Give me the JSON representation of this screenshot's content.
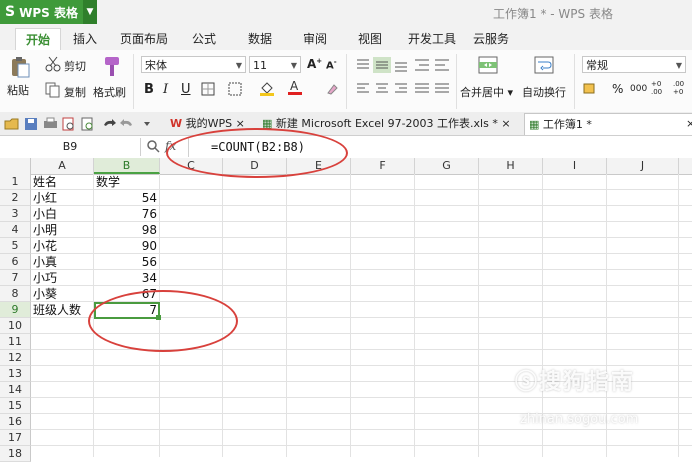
{
  "app": {
    "name": "WPS 表格",
    "window_title": "工作簿1 * - WPS 表格"
  },
  "menu_tabs": [
    "开始",
    "插入",
    "页面布局",
    "公式",
    "数据",
    "审阅",
    "视图",
    "开发工具",
    "云服务"
  ],
  "ribbon": {
    "cut": "剪切",
    "paste": "粘贴",
    "copy": "复制",
    "format_painter": "格式刷",
    "font_name": "宋体",
    "font_size": "11",
    "bold": "B",
    "italic": "I",
    "underline": "U",
    "merge_center": "合并居中",
    "wrap_text": "自动换行",
    "number_format": "常规",
    "percent": "%",
    "comma": "000",
    "dec_inc": "+0 .00",
    "dec_dec": ".00 +0"
  },
  "doc_tabs": [
    "我的WPS",
    "新建 Microsoft Excel 97-2003 工作表.xls *",
    "工作簿1 *"
  ],
  "formula_bar": {
    "name_box": "B9",
    "fx": "fx",
    "formula": "=COUNT(B2:B8)"
  },
  "columns": [
    "A",
    "B",
    "C",
    "D",
    "E",
    "F",
    "G",
    "H",
    "I",
    "J"
  ],
  "rows": [
    "1",
    "2",
    "3",
    "4",
    "5",
    "6",
    "7",
    "8",
    "9",
    "10",
    "11",
    "12",
    "13",
    "14",
    "15",
    "16",
    "17",
    "18"
  ],
  "cells": [
    {
      "a": "姓名",
      "b": "数学"
    },
    {
      "a": "小红",
      "b": "54"
    },
    {
      "a": "小白",
      "b": "76"
    },
    {
      "a": "小明",
      "b": "98"
    },
    {
      "a": "小花",
      "b": "90"
    },
    {
      "a": "小真",
      "b": "56"
    },
    {
      "a": "小巧",
      "b": "34"
    },
    {
      "a": "小葵",
      "b": "67"
    },
    {
      "a": "班级人数",
      "b": "7"
    }
  ],
  "watermark": {
    "brand": "搜狗指南",
    "url": "zhinan.sogou.com"
  },
  "colors": {
    "accent": "#3f9a3a",
    "annotation": "#d8413c"
  }
}
